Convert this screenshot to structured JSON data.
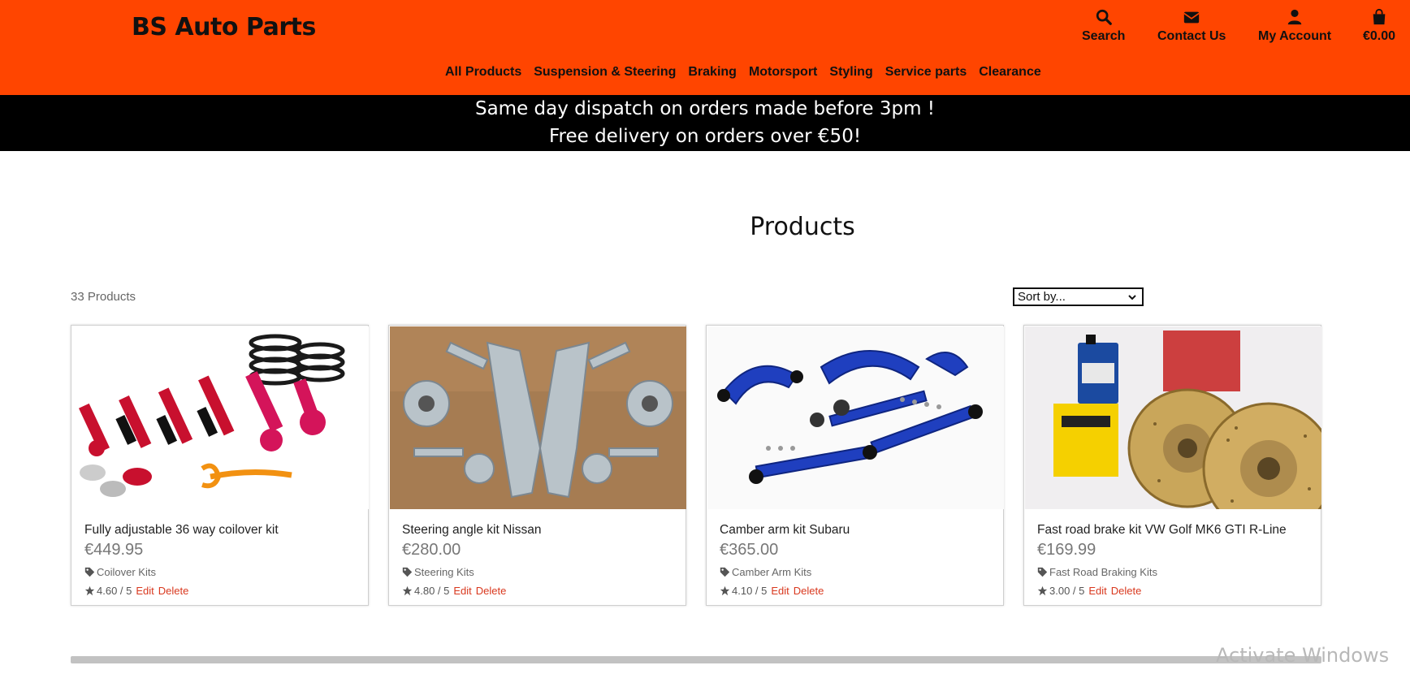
{
  "header": {
    "brand": "BS Auto Parts",
    "background": "#ff4500",
    "utilities": {
      "search": {
        "label": "Search",
        "icon": "search-icon"
      },
      "contact": {
        "label": "Contact Us",
        "icon": "envelope-icon"
      },
      "account": {
        "label": "My Account",
        "icon": "user-icon"
      },
      "bag": {
        "label": "€0.00",
        "icon": "shopping-bag-icon"
      }
    },
    "nav": [
      "All Products",
      "Suspension & Steering",
      "Braking",
      "Motorsport",
      "Styling",
      "Service parts",
      "Clearance"
    ]
  },
  "banner": {
    "line1": "Same day dispatch on orders made before 3pm !",
    "line2": "Free delivery on orders over €50!"
  },
  "main": {
    "title": "Products",
    "count": "33 Products",
    "sort": {
      "selected": "Sort by..."
    },
    "edit_label": "Edit",
    "delete_label": "Delete",
    "products": [
      {
        "name": "Fully adjustable 36 way coilover kit",
        "price": "€449.95",
        "category": "Coilover Kits",
        "rating": "4.60 / 5"
      },
      {
        "name": "Steering angle kit Nissan",
        "price": "€280.00",
        "category": "Steering Kits",
        "rating": "4.80 / 5"
      },
      {
        "name": "Camber arm kit Subaru",
        "price": "€365.00",
        "category": "Camber Arm Kits",
        "rating": "4.10 / 5"
      },
      {
        "name": "Fast road brake kit VW Golf MK6 GTI R-Line",
        "price": "€169.99",
        "category": "Fast Road Braking Kits",
        "rating": "3.00 / 5"
      }
    ]
  },
  "watermark": "Activate Windows",
  "colors": {
    "accent": "#ff4500",
    "link": "#d9381e",
    "banner": "#000000"
  }
}
